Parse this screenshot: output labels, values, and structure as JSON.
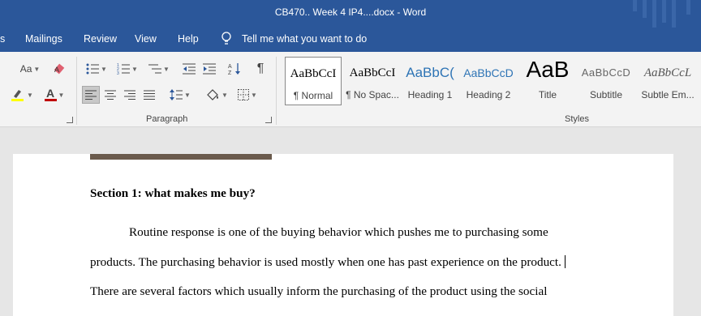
{
  "window": {
    "title": "CB470.. Week 4 IP4....docx  -  Word"
  },
  "menu": {
    "tabs": [
      "s",
      "Mailings",
      "Review",
      "View",
      "Help"
    ],
    "tell_me": "Tell me what you want to do"
  },
  "ribbon": {
    "font_case_label": "Aa",
    "font_color_letter": "A",
    "paragraph_label": "Paragraph",
    "styles_label": "Styles",
    "styles": [
      {
        "sample": "AaBbCcI",
        "name": "¶ Normal"
      },
      {
        "sample": "AaBbCcI",
        "name": "¶ No Spac..."
      },
      {
        "sample": "AaBbC(",
        "name": "Heading 1"
      },
      {
        "sample": "AaBbCcD",
        "name": "Heading 2"
      },
      {
        "sample": "AaB",
        "name": "Title"
      },
      {
        "sample": "AaBbCcD",
        "name": "Subtitle"
      },
      {
        "sample": "AaBbCcL",
        "name": "Subtle Em..."
      }
    ]
  },
  "document": {
    "heading": "Section 1: what makes me buy?",
    "line1": "Routine response is one of the buying behavior which pushes me to purchasing some",
    "line2": "products. The purchasing behavior is used mostly when one has past experience on the product.",
    "line3": "There are several factors which usually inform the purchasing of the product using the social"
  },
  "colors": {
    "title_bar": "#2b579a",
    "ribbon": "#f3f3f3",
    "canvas": "#e6e6e6",
    "font_color_underline": "#c00000",
    "highlight": "#ffff00"
  }
}
